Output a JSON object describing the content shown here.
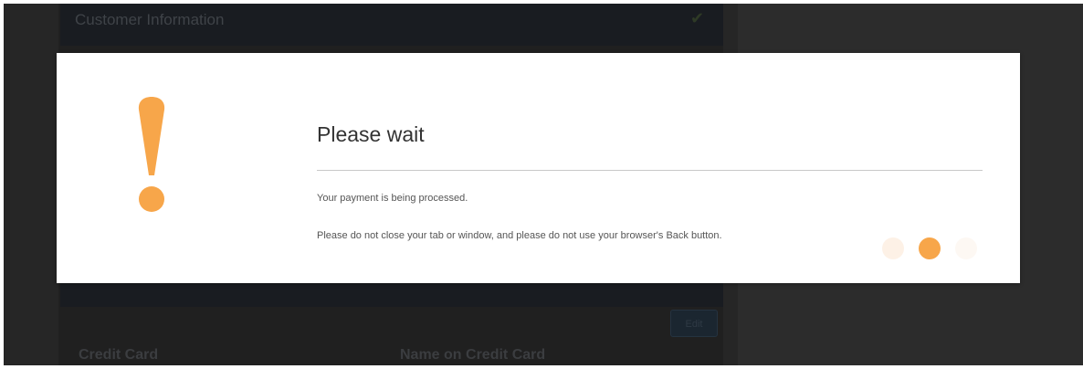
{
  "background": {
    "card_title": "Customer Information",
    "edit_button": "Edit",
    "credit_card_label": "Credit Card",
    "name_on_card_label": "Name on Credit Card"
  },
  "modal": {
    "title": "Please wait",
    "message_1": "Your payment is being processed.",
    "message_2": "Please do not close your tab or window, and please do not use your browser's Back button.",
    "icon": "exclamation-icon",
    "accent_color": "#f7a64a"
  },
  "loader": {
    "dots": 3,
    "active_dot": 2
  }
}
